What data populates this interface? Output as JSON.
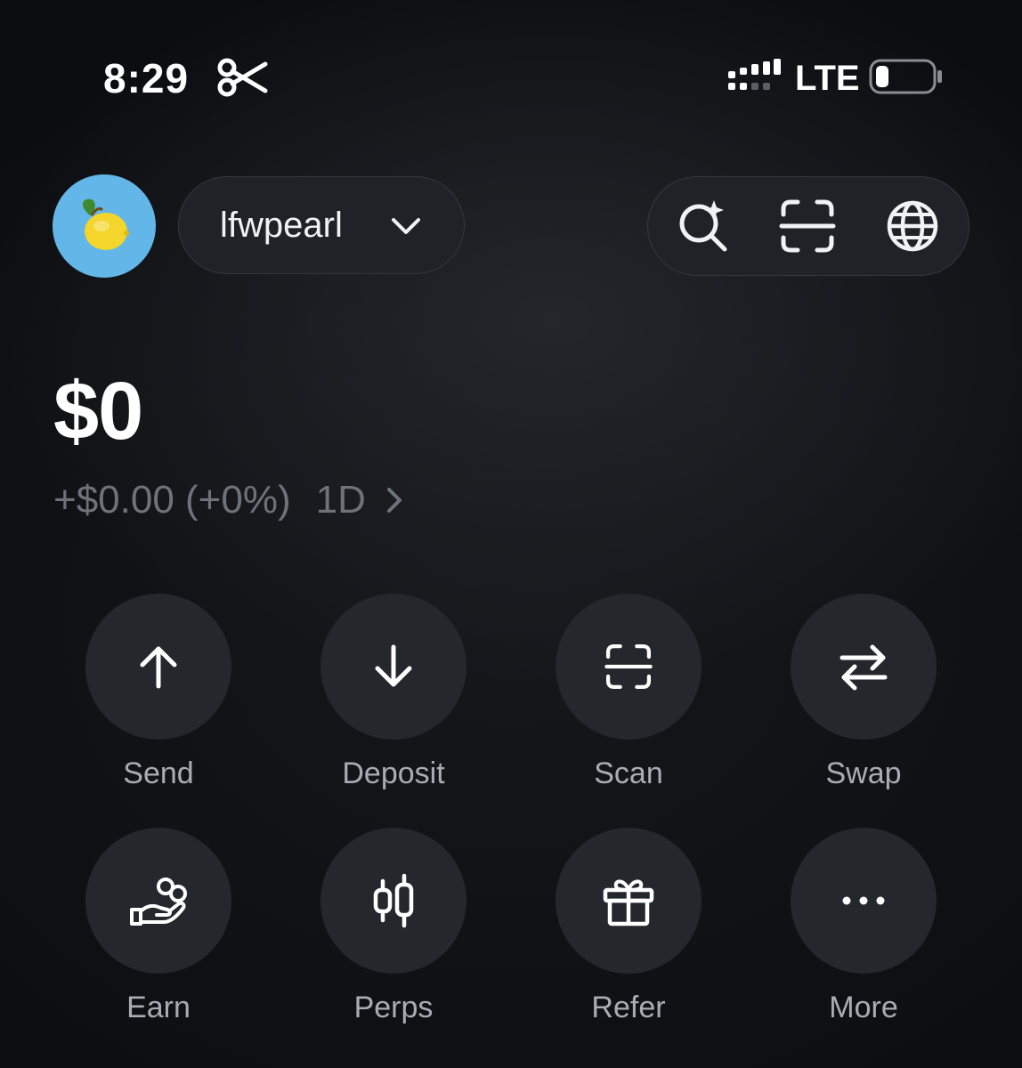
{
  "status_bar": {
    "time": "8:29",
    "network": "LTE",
    "icons": [
      "scissors-icon",
      "cellular-signal-icon",
      "battery-low-icon"
    ]
  },
  "header": {
    "avatar_icon": "lemon-icon",
    "avatar_color": "#62b7e8",
    "account_name": "lfwpearl",
    "tools": [
      "ai-search-icon",
      "scan-icon",
      "globe-icon"
    ]
  },
  "balance": {
    "amount": "$0",
    "change": "+$0.00 (+0%)",
    "period": "1D"
  },
  "actions": [
    {
      "label": "Send",
      "icon": "arrow-up-icon"
    },
    {
      "label": "Deposit",
      "icon": "arrow-down-icon"
    },
    {
      "label": "Scan",
      "icon": "scan-icon"
    },
    {
      "label": "Swap",
      "icon": "swap-arrows-icon"
    },
    {
      "label": "Earn",
      "icon": "hand-coins-icon"
    },
    {
      "label": "Perps",
      "icon": "candlestick-icon"
    },
    {
      "label": "Refer",
      "icon": "gift-icon"
    },
    {
      "label": "More",
      "icon": "more-dots-icon"
    }
  ],
  "colors": {
    "background": "#0e0f12",
    "surface": "#24272b",
    "muted_text": "#6e7279",
    "label_text": "#a9adb3"
  }
}
